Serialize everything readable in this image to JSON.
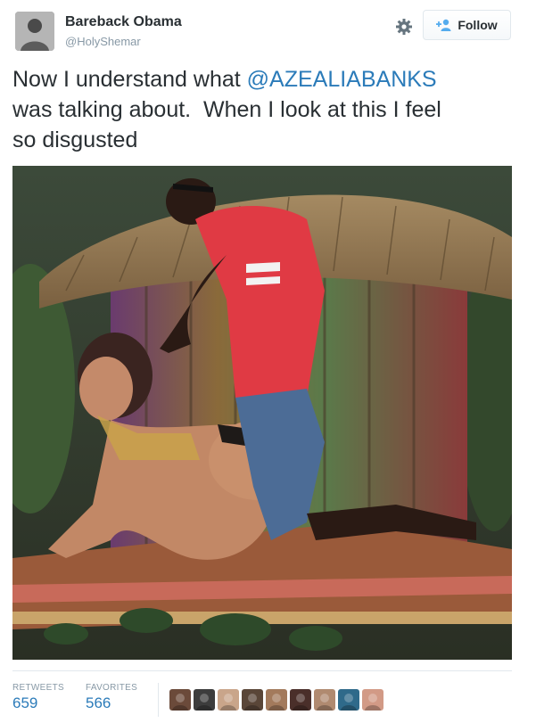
{
  "author": {
    "display_name": "Bareback Obama",
    "screen_name": "@HolyShemar",
    "avatar_icon": "user-avatar"
  },
  "actions": {
    "settings_icon": "gear-icon",
    "follow_label": "Follow",
    "follow_icon": "add-user-icon"
  },
  "tweet": {
    "line1_prefix": "Now I understand what ",
    "mention": "@AZEALIABANKS",
    "line2": "was talking about.  When I look at this I feel",
    "line3": "so disgusted"
  },
  "stats": {
    "retweets_label": "RETWEETS",
    "retweets_count": "659",
    "favorites_label": "FAVORITES",
    "favorites_count": "566"
  },
  "favoriters": [
    {
      "color": "#6b4a3a"
    },
    {
      "color": "#3d3d3d"
    },
    {
      "color": "#c9a58a"
    },
    {
      "color": "#5a4638"
    },
    {
      "color": "#a37a5c"
    },
    {
      "color": "#4a2f2a"
    },
    {
      "color": "#b08a70"
    },
    {
      "color": "#2f6a8a"
    },
    {
      "color": "#d29a86"
    }
  ],
  "colors": {
    "link": "#2b7bb9",
    "muted": "#8899a6",
    "text": "#292f33",
    "border": "#e1e8ed"
  }
}
